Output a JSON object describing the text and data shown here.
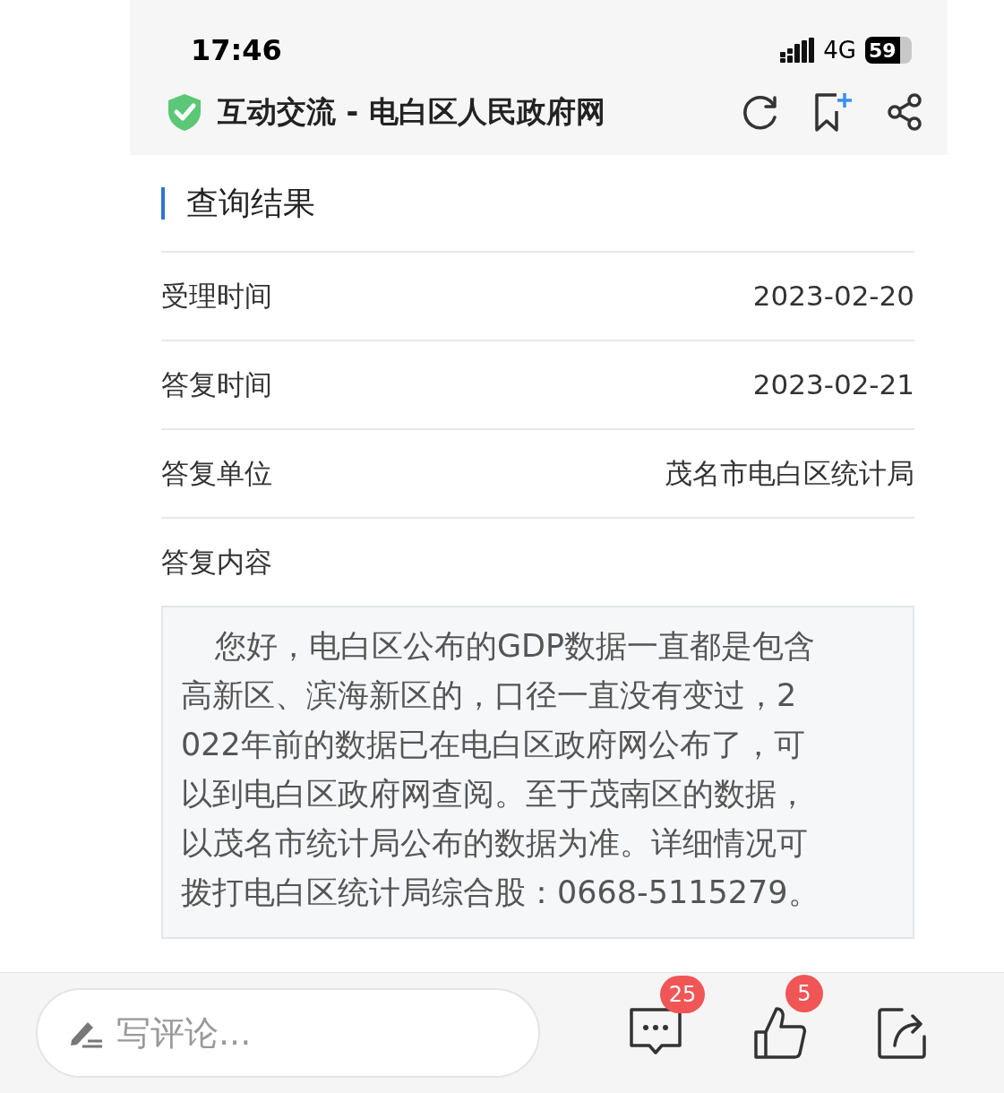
{
  "status_bar": {
    "time": "17:46",
    "network": "4G",
    "battery": "59"
  },
  "browser_bar": {
    "title": "互动交流 - 电白区人民政府网",
    "secure": true
  },
  "section_title": "查询结果",
  "fields": [
    {
      "label": "受理时间",
      "value": "2023-02-20"
    },
    {
      "label": "答复时间",
      "value": "2023-02-21"
    },
    {
      "label": "答复单位",
      "value": "茂名市电白区统计局"
    }
  ],
  "answer": {
    "label": "答复内容",
    "lines": [
      "您好，电白区公布的GDP数据一直都是包含",
      "高新区、滨海新区的，口径一直没有变过，2",
      "022年前的数据已在电白区政府网公布了，可",
      "以到电白区政府网查阅。至于茂南区的数据，",
      "以茂名市统计局公布的数据为准。详细情况可",
      "拨打电白区统计局综合股：0668-5115279。"
    ]
  },
  "bottom_bar": {
    "placeholder": "写评论...",
    "comment_count": "25",
    "like_count": "5"
  }
}
